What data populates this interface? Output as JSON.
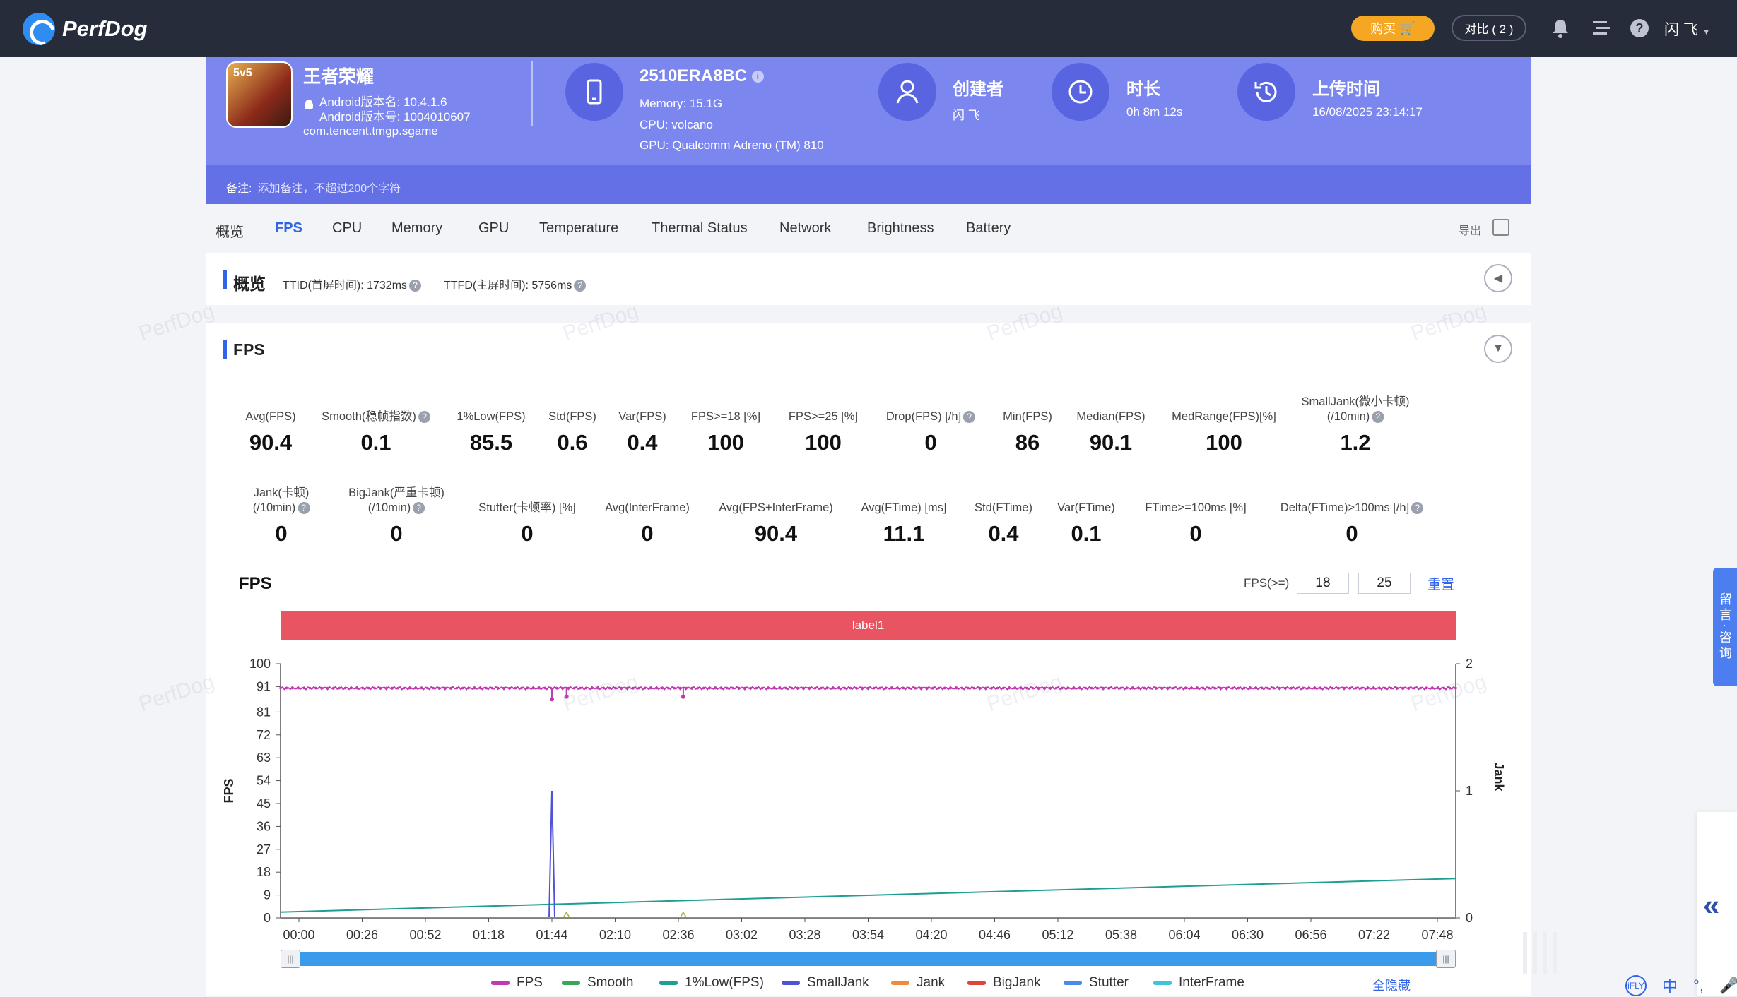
{
  "app": {
    "brand": "PerfDog"
  },
  "topbar": {
    "buy": "购买",
    "compare": "对比 ( 2 )",
    "user": "闪 飞"
  },
  "header": {
    "game_title": "王者荣耀",
    "icon_badge": "5v5",
    "version_name": "Android版本名: 10.4.1.6",
    "version_code": "Android版本号: 1004010607",
    "package": "com.tencent.tmgp.sgame",
    "device": "2510ERA8BC",
    "memory": "Memory: 15.1G",
    "cpu": "CPU: volcano",
    "gpu": "GPU: Qualcomm Adreno (TM) 810",
    "creator_label": "创建者",
    "creator": "闪 飞",
    "duration_label": "时长",
    "duration": "0h 8m 12s",
    "upload_label": "上传时间",
    "upload_time": "16/08/2025 23:14:17",
    "note_label": "备注:",
    "note_placeholder": "添加备注，不超过200个字符"
  },
  "tabs": [
    "概览",
    "FPS",
    "CPU",
    "Memory",
    "GPU",
    "Temperature",
    "Thermal Status",
    "Network",
    "Brightness",
    "Battery"
  ],
  "active_tab": "FPS",
  "export_label": "导出",
  "overview": {
    "title": "概览",
    "ttid": "TTID(首屏时间): 1732ms",
    "ttfd": "TTFD(主屏时间): 5756ms"
  },
  "fps_section": {
    "title": "FPS"
  },
  "stats_row1": [
    {
      "label": "Avg(FPS)",
      "value": "90.4"
    },
    {
      "label": "Smooth(稳帧指数)",
      "value": "0.1",
      "help": true
    },
    {
      "label": "1%Low(FPS)",
      "value": "85.5"
    },
    {
      "label": "Std(FPS)",
      "value": "0.6"
    },
    {
      "label": "Var(FPS)",
      "value": "0.4"
    },
    {
      "label": "FPS>=18 [%]",
      "value": "100"
    },
    {
      "label": "FPS>=25 [%]",
      "value": "100"
    },
    {
      "label": "Drop(FPS) [/h]",
      "value": "0",
      "help": true
    },
    {
      "label": "Min(FPS)",
      "value": "86"
    },
    {
      "label": "Median(FPS)",
      "value": "90.1"
    },
    {
      "label": "MedRange(FPS)[%]",
      "value": "100"
    },
    {
      "label": "SmallJank(微小卡顿)",
      "label2": "(/10min)",
      "value": "1.2",
      "help": true
    }
  ],
  "stats_row2": [
    {
      "label": "Jank(卡顿)",
      "label2": "(/10min)",
      "value": "0",
      "help": true
    },
    {
      "label": "BigJank(严重卡顿)",
      "label2": "(/10min)",
      "value": "0",
      "help": true
    },
    {
      "label": "Stutter(卡顿率) [%]",
      "value": "0"
    },
    {
      "label": "Avg(InterFrame)",
      "value": "0"
    },
    {
      "label": "Avg(FPS+InterFrame)",
      "value": "90.4"
    },
    {
      "label": "Avg(FTime) [ms]",
      "value": "11.1"
    },
    {
      "label": "Std(FTime)",
      "value": "0.4"
    },
    {
      "label": "Var(FTime)",
      "value": "0.1"
    },
    {
      "label": "FTime>=100ms [%]",
      "value": "0"
    },
    {
      "label": "Delta(FTime)>100ms [/h]",
      "value": "0",
      "help": true
    }
  ],
  "chart_controls": {
    "title": "FPS",
    "filter_label": "FPS(>=)",
    "threshold1": "18",
    "threshold2": "25",
    "reset": "重置",
    "label_bar": "label1",
    "hide_all": "全隐藏"
  },
  "chart_data": {
    "type": "line",
    "ylabel": "FPS",
    "y2label": "Jank",
    "ylim": [
      0,
      100
    ],
    "y2lim": [
      0,
      2
    ],
    "yticks": [
      "100",
      "91",
      "81",
      "72",
      "63",
      "54",
      "45",
      "36",
      "27",
      "18",
      "9",
      "0"
    ],
    "y2ticks": [
      "2",
      "1",
      "0"
    ],
    "xticks": [
      "00:00",
      "00:26",
      "00:52",
      "01:18",
      "01:44",
      "02:10",
      "02:36",
      "03:02",
      "03:28",
      "03:54",
      "04:20",
      "04:46",
      "05:12",
      "05:38",
      "06:04",
      "06:30",
      "06:56",
      "07:22",
      "07:48"
    ],
    "series": [
      {
        "name": "FPS",
        "color": "#c03ab0",
        "baseline": 90.4,
        "dips": [
          {
            "t": "01:44",
            "value": 86
          },
          {
            "t": "01:50",
            "value": 87
          },
          {
            "t": "02:38",
            "value": 87
          }
        ]
      },
      {
        "name": "Smooth",
        "color": "#3aa65a"
      },
      {
        "name": "1%Low(FPS)",
        "color": "#1f9e94",
        "start": 2.3,
        "end": 15.5
      },
      {
        "name": "SmallJank",
        "color": "#4f52d6",
        "spike": {
          "t": "01:44",
          "value": 1
        }
      },
      {
        "name": "Jank",
        "color": "#f08a3c"
      },
      {
        "name": "BigJank",
        "color": "#e0443a"
      },
      {
        "name": "Stutter",
        "color": "#4a8be6"
      },
      {
        "name": "InterFrame",
        "color": "#3cc6d6"
      }
    ]
  },
  "side": {
    "consult": "留言·咨询"
  },
  "ime": [
    "iFLY",
    "中",
    "°,",
    "🎤"
  ]
}
